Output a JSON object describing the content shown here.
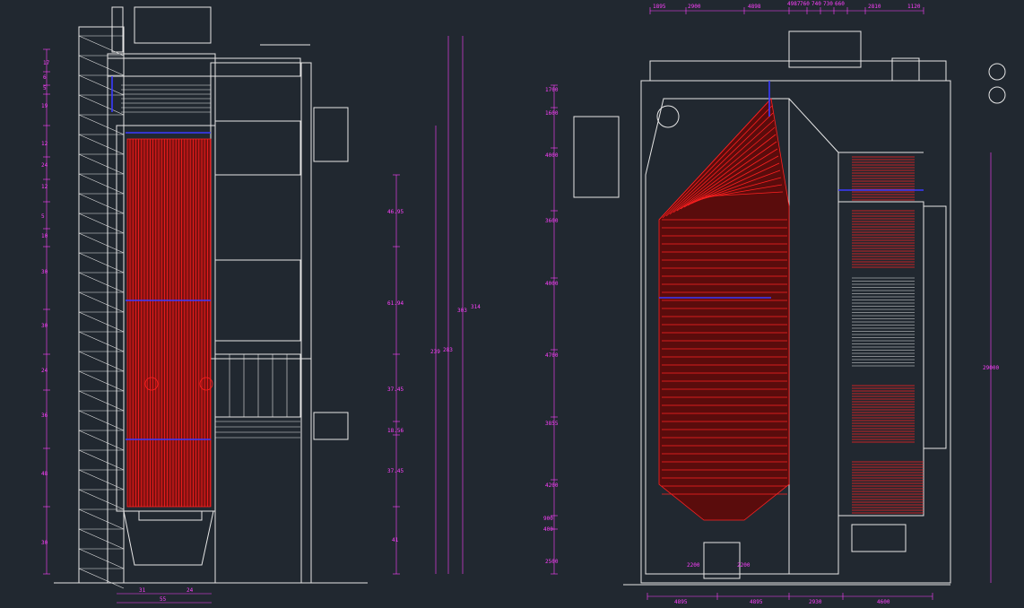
{
  "drawing": {
    "left_view": {
      "vertical_dims": [
        "17",
        "6",
        "5",
        "19",
        "12",
        "24",
        "12",
        "5",
        "10",
        "30",
        "30",
        "24",
        "36",
        "48",
        "30"
      ],
      "right_dims": [
        "46.95",
        "61.94",
        "37.45",
        "18.56",
        "37.45",
        "41"
      ],
      "tall_dims": [
        "239",
        "283",
        "303",
        "314"
      ],
      "bottom_dims": [
        "31",
        "24",
        "55"
      ]
    },
    "right_view": {
      "top_dims": [
        "1895",
        "2900",
        "4898",
        "4987",
        "760",
        "740",
        "730",
        "660",
        "2810",
        "1120"
      ],
      "left_dims": [
        "1700",
        "1600",
        "4000",
        "3600",
        "4000",
        "4700",
        "3855",
        "4200",
        "900",
        "400",
        "2500"
      ],
      "right_dims": [
        "29000"
      ],
      "bottom_dims": [
        "4895",
        "4895",
        "2200",
        "2200",
        "2930",
        "4600"
      ]
    },
    "colors": {
      "background": "#212830",
      "lines": "#e6e6e6",
      "tubes": "#ff2020",
      "dimensions": "#ff40ff",
      "headers": "#3a3aff"
    }
  }
}
